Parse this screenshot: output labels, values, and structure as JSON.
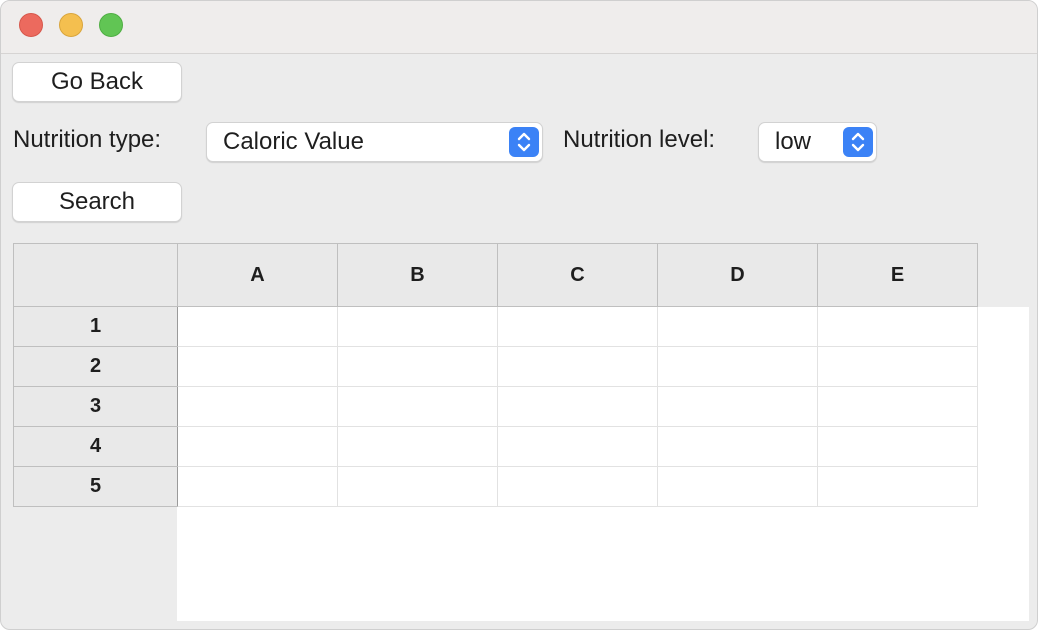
{
  "toolbar": {
    "go_back_label": "Go Back",
    "search_label": "Search"
  },
  "filters": {
    "nutrition_type_label": "Nutrition type:",
    "nutrition_type_value": "Caloric Value",
    "nutrition_level_label": "Nutrition level:",
    "nutrition_level_value": "low"
  },
  "table": {
    "columns": [
      "A",
      "B",
      "C",
      "D",
      "E"
    ],
    "rows": [
      "1",
      "2",
      "3",
      "4",
      "5"
    ]
  },
  "colors": {
    "accent": "#3b82f6",
    "close": "#ec6a5e",
    "minimize": "#f4bf4f",
    "zoom": "#61c554"
  }
}
